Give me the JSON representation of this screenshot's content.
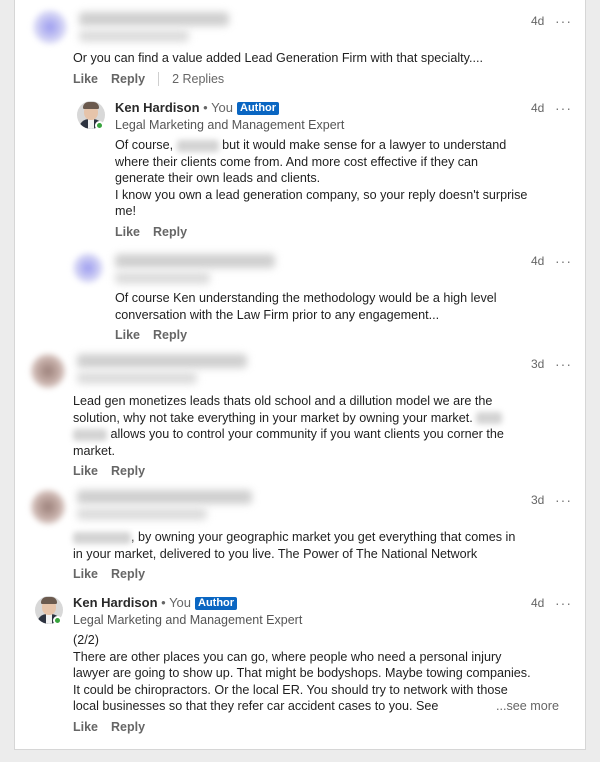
{
  "colors": {
    "accent": "#0a66c2",
    "online": "#37a33d"
  },
  "comments": [
    {
      "time": "4d",
      "body": [
        "Or you can find a value added Lead Generation Firm with that specialty...."
      ],
      "like": "Like",
      "reply": "Reply",
      "replies": "2 Replies"
    },
    {
      "name": "Ken Hardison",
      "you": "• You",
      "badge": "Author",
      "headline": "Legal Marketing and Management Expert",
      "time": "4d",
      "body_line1_a": "Of course,",
      "body_line1_b": "but it would make sense for a lawyer to understand",
      "body": [
        "where their clients come from. And more cost effective if they can",
        "generate their own leads and clients.",
        "I know you own a lead generation company, so your reply doesn't surprise",
        "me!"
      ],
      "like": "Like",
      "reply": "Reply"
    },
    {
      "time": "4d",
      "body": [
        "Of course Ken understanding the methodology would be a high level",
        "conversation with the Law Firm prior to any engagement..."
      ],
      "like": "Like",
      "reply": "Reply"
    },
    {
      "time": "3d",
      "body": [
        "Lead gen monetizes leads thats old school and a dillution model we are the",
        "solution, why not take everything in your market by owning your market."
      ],
      "body_line3": "allows you to control your community if you want clients you corner the",
      "body_line4": "market.",
      "like": "Like",
      "reply": "Reply"
    },
    {
      "time": "3d",
      "body_line1": ", by owning your geographic market you get everything that comes in",
      "body": [
        "in your market, delivered to you live. The Power of The National Network"
      ],
      "like": "Like",
      "reply": "Reply"
    },
    {
      "name": "Ken Hardison",
      "you": "• You",
      "badge": "Author",
      "headline": "Legal Marketing and Management Expert",
      "time": "4d",
      "body": [
        "(2/2)",
        "There are other places you can go, where people who need a personal injury",
        "lawyer are going to show up. That might be bodyshops. Maybe towing companies.",
        "It could be chiropractors. Or the local ER. You should try to network with those"
      ],
      "body_last": "local businesses so that they refer car accident cases to you. See",
      "see_more": "...see more",
      "like": "Like",
      "reply": "Reply"
    }
  ],
  "more_icon": "···"
}
